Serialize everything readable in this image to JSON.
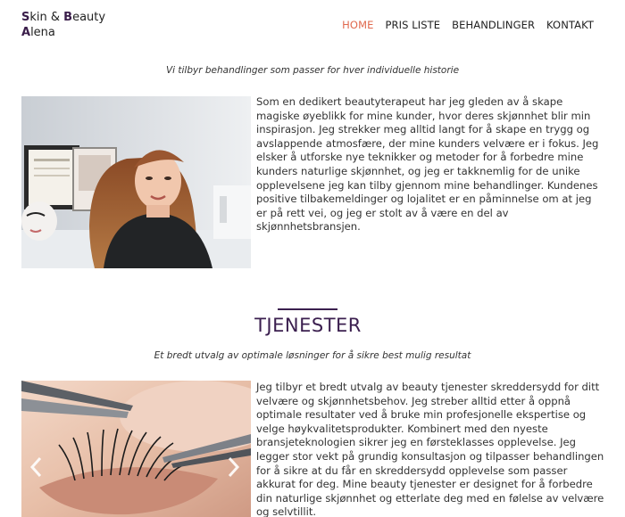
{
  "brand": {
    "line1_initial_s": "S",
    "line1_rest_a": "kin & ",
    "line1_initial_b": "B",
    "line1_rest_b": "eauty",
    "line2_initial": "A",
    "line2_rest": "lena"
  },
  "nav": {
    "items": [
      {
        "label": "HOME",
        "active": true
      },
      {
        "label": "PRIS LISTE"
      },
      {
        "label": "BEHANDLINGER"
      },
      {
        "label": "KONTAKT"
      }
    ]
  },
  "about": {
    "tagline": "Vi tilbyr behandlinger som passer for hver individuelle historie",
    "body": "Som en dedikert beautyterapeut har jeg gleden av å skape magiske øyeblikk for mine kunder, hvor deres skjønnhet blir min inspirasjon. Jeg strekker meg alltid langt for å skape en trygg og avslappende atmosfære, der mine kunders velvære er i fokus. Jeg elsker å utforske nye teknikker og metoder for å forbedre mine kunders naturlige skjønnhet, og jeg er takknemlig for de unike opplevelsene jeg kan tilby gjennom mine behandlinger. Kundenes positive tilbakemeldinger og lojalitet er en påminnelse om at jeg er på rett vei, og jeg er stolt av å være en del av skjønnhetsbransjen."
  },
  "services": {
    "title": "TJENESTER",
    "tagline": "Et bredt utvalg av optimale løsninger for å sikre best mulig resultat",
    "body": "Jeg tilbyr et bredt utvalg av beauty tjenester skreddersydd for ditt velvære og skjønnhetsbehov. Jeg streber alltid etter å oppnå optimale resultater ved å bruke min profesjonelle ekspertise og velge høykvalitetsprodukter. Kombinert med den nyeste bransjeteknologien sikrer jeg en førsteklasses opplevelse. Jeg legger stor vekt på grundig konsultasjon og tilpasser behandlingen for å sikre at du får en skreddersydd opplevelse som passer akkurat for deg. Mine beauty tjenester er designet for å forbedre din naturlige skjønnhet og etterlate deg med en følelse av velvære og selvtillit."
  },
  "colors": {
    "accent": "#e0694e",
    "brand_purple": "#3b1f4f"
  },
  "icons": {
    "prev": "chevron-left-icon",
    "next": "chevron-right-icon"
  }
}
